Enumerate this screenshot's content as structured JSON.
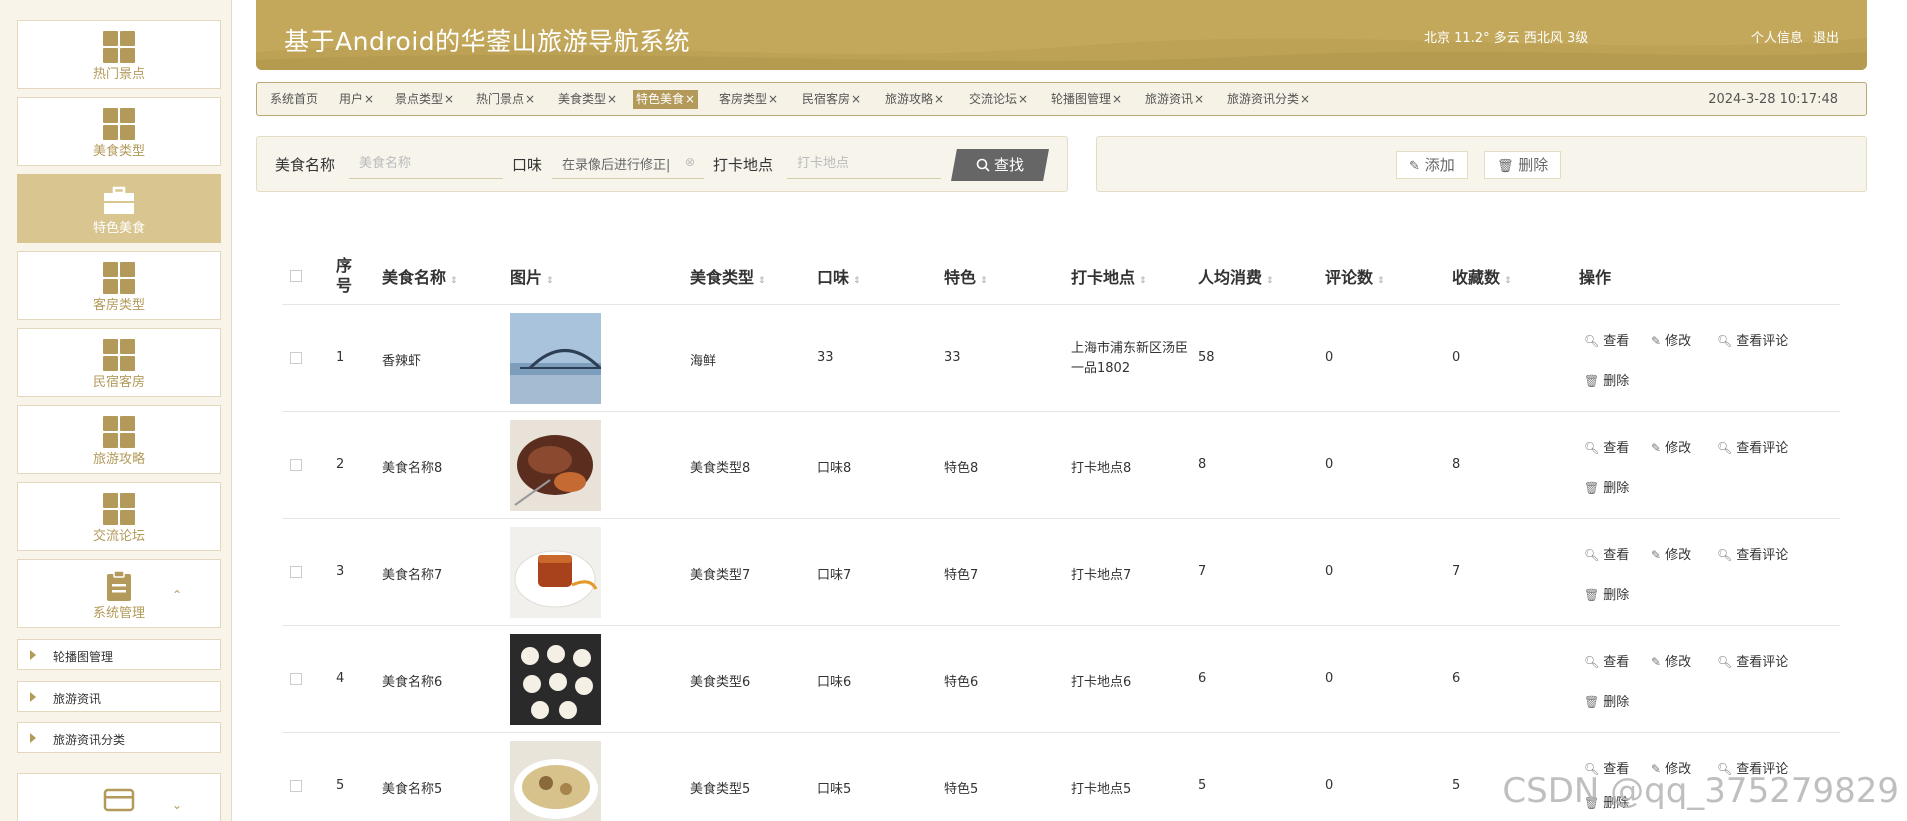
{
  "header": {
    "title": "基于Android的华蓥山旅游导航系统",
    "weather": "北京 11.2° 多云 西北风 3级",
    "profile_link": "个人信息",
    "logout_link": "退出"
  },
  "sidebar": {
    "items": [
      {
        "label": "热门景点"
      },
      {
        "label": "美食类型"
      },
      {
        "label": "特色美食"
      },
      {
        "label": "客房类型"
      },
      {
        "label": "民宿客房"
      },
      {
        "label": "旅游攻略"
      },
      {
        "label": "交流论坛"
      },
      {
        "label": "系统管理"
      }
    ],
    "subitems": [
      {
        "label": "轮播图管理"
      },
      {
        "label": "旅游资讯"
      },
      {
        "label": "旅游资讯分类"
      }
    ]
  },
  "tabs": [
    {
      "label": "系统首页"
    },
    {
      "label": "用户"
    },
    {
      "label": "景点类型"
    },
    {
      "label": "热门景点"
    },
    {
      "label": "美食类型"
    },
    {
      "label": "特色美食"
    },
    {
      "label": "客房类型"
    },
    {
      "label": "民宿客房"
    },
    {
      "label": "旅游攻略"
    },
    {
      "label": "交流论坛"
    },
    {
      "label": "轮播图管理"
    },
    {
      "label": "旅游资讯"
    },
    {
      "label": "旅游资讯分类"
    }
  ],
  "tab_close": "×",
  "datetime": "2024-3-28 10:17:48",
  "search": {
    "name_label": "美食名称",
    "name_placeholder": "美食名称",
    "taste_label": "口味",
    "taste_value": "在录像后进行修正|",
    "location_label": "打卡地点",
    "location_placeholder": "打卡地点",
    "search_button": "查找"
  },
  "actions": {
    "add": "添加",
    "delete": "删除"
  },
  "table": {
    "headers": {
      "index": "序号",
      "name": "美食名称",
      "image": "图片",
      "type": "美食类型",
      "taste": "口味",
      "feature": "特色",
      "location": "打卡地点",
      "price": "人均消费",
      "comments": "评论数",
      "favorites": "收藏数",
      "ops": "操作"
    },
    "ops": {
      "view": "查看",
      "edit": "修改",
      "view_comments": "查看评论",
      "delete": "删除"
    },
    "rows": [
      {
        "index": "1",
        "name": "香辣虾",
        "type": "海鲜",
        "taste": "33",
        "feature": "33",
        "location": "上海市浦东新区汤臣一品1802",
        "price": "58",
        "comments": "0",
        "favorites": "0"
      },
      {
        "index": "2",
        "name": "美食名称8",
        "type": "美食类型8",
        "taste": "口味8",
        "feature": "特色8",
        "location": "打卡地点8",
        "price": "8",
        "comments": "0",
        "favorites": "8"
      },
      {
        "index": "3",
        "name": "美食名称7",
        "type": "美食类型7",
        "taste": "口味7",
        "feature": "特色7",
        "location": "打卡地点7",
        "price": "7",
        "comments": "0",
        "favorites": "7"
      },
      {
        "index": "4",
        "name": "美食名称6",
        "type": "美食类型6",
        "taste": "口味6",
        "feature": "特色6",
        "location": "打卡地点6",
        "price": "6",
        "comments": "0",
        "favorites": "6"
      },
      {
        "index": "5",
        "name": "美食名称5",
        "type": "美食类型5",
        "taste": "口味5",
        "feature": "特色5",
        "location": "打卡地点5",
        "price": "5",
        "comments": "0",
        "favorites": "5"
      }
    ]
  },
  "watermark": "CSDN @qq_375279829",
  "colors": {
    "accent": "#c3a85c",
    "accent_dark": "#b39a5a",
    "sidebar_active": "#d8c58f",
    "search_button": "#666666"
  }
}
